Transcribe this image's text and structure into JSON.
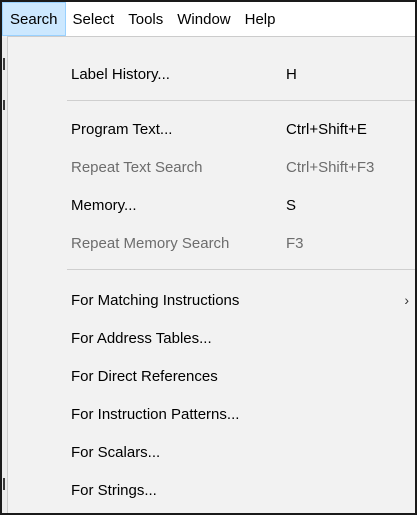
{
  "menubar": {
    "items": [
      {
        "label": "Search",
        "active": true
      },
      {
        "label": "Select",
        "active": false
      },
      {
        "label": "Tools",
        "active": false
      },
      {
        "label": "Window",
        "active": false
      },
      {
        "label": "Help",
        "active": false
      }
    ]
  },
  "menu": {
    "items": [
      {
        "label": "Label History...",
        "shortcut": "H",
        "enabled": true
      },
      {
        "label": "Program Text...",
        "shortcut": "Ctrl+Shift+E",
        "enabled": true
      },
      {
        "label": "Repeat Text Search",
        "shortcut": "Ctrl+Shift+F3",
        "enabled": false
      },
      {
        "label": "Memory...",
        "shortcut": "S",
        "enabled": true
      },
      {
        "label": "Repeat Memory Search",
        "shortcut": "F3",
        "enabled": false
      },
      {
        "label": "For Matching Instructions",
        "shortcut": "",
        "enabled": true,
        "submenu_icon": "chevron-right-icon",
        "submenu_glyph": "›"
      },
      {
        "label": "For Address Tables...",
        "shortcut": "",
        "enabled": true
      },
      {
        "label": "For Direct References",
        "shortcut": "",
        "enabled": true
      },
      {
        "label": "For Instruction Patterns...",
        "shortcut": "",
        "enabled": true
      },
      {
        "label": "For Scalars...",
        "shortcut": "",
        "enabled": true
      },
      {
        "label": "For Strings...",
        "shortcut": "",
        "enabled": true
      }
    ]
  },
  "colors": {
    "menubar_active_bg": "#cce8ff",
    "menu_bg": "#f2f2f2",
    "disabled_text": "#6d6d6d"
  }
}
